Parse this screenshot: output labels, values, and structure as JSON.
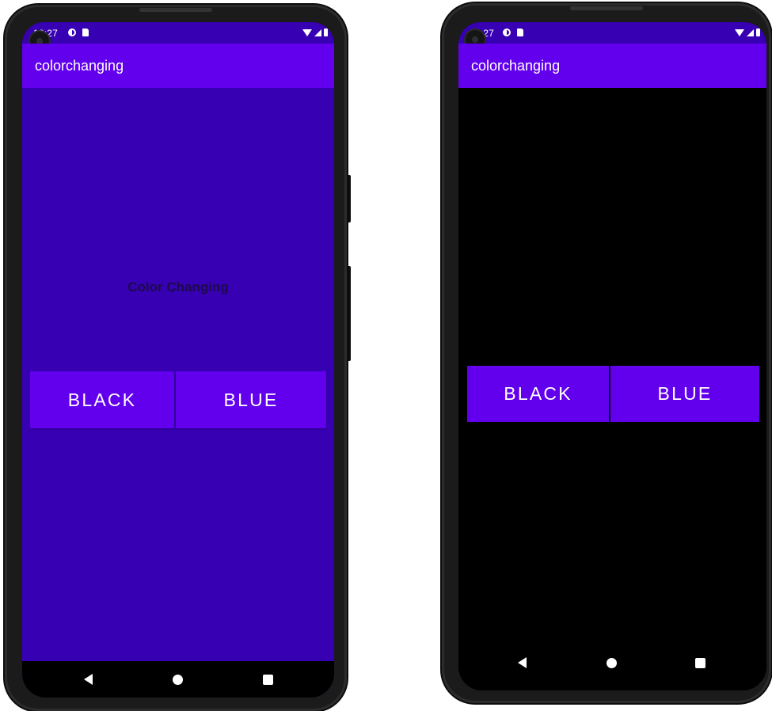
{
  "colors": {
    "primary": "#6200ee",
    "primary_dark": "#3700b3",
    "black": "#000000",
    "text_on_primary": "#ffffff"
  },
  "status_bar": {
    "time": "12:27",
    "left_icons": [
      "data-saver-icon",
      "sd-card-icon"
    ],
    "right_icons": [
      "wifi-icon",
      "signal-icon",
      "battery-icon"
    ]
  },
  "screens": [
    {
      "app_title": "colorchanging",
      "background": "#3700b3",
      "center_text": "Color Changing",
      "buttons": {
        "black_label": "BLACK",
        "blue_label": "BLUE"
      }
    },
    {
      "app_title": "colorchanging",
      "background": "#000000",
      "buttons": {
        "black_label": "BLACK",
        "blue_label": "BLUE"
      }
    }
  ],
  "nav_bar": {
    "icons": [
      "back-icon",
      "home-icon",
      "recents-icon"
    ]
  }
}
